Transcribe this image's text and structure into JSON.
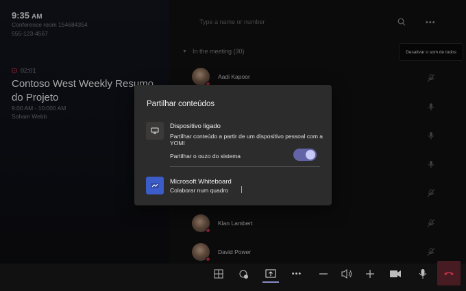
{
  "clock": {
    "time": "9:35",
    "ampm": "AM"
  },
  "room": {
    "name": "Conference room 154684354",
    "phone": "555-123-4567"
  },
  "meeting": {
    "timer": "02:01",
    "title": "Contoso West Weekly Resumo do Projeto",
    "time_range": "9:00 AM - 10:000 AM",
    "organizer": "Soham Webb"
  },
  "search": {
    "placeholder": "Type a name or number"
  },
  "roster": {
    "section_label": "In the meeting (30)",
    "mute_all_tooltip": "Desativar o som de todos",
    "participants": [
      {
        "name": "Aadi Kapoor"
      },
      {
        "name": "Kian Lambert"
      },
      {
        "name": "David Power"
      }
    ]
  },
  "share_dialog": {
    "title": "Partilhar conteúdos",
    "device_option": {
      "title": "Dispositivo ligado",
      "subtitle": "Partilhar conteúdo a partir de um dispositivo pessoal com a YOMI"
    },
    "system_audio": {
      "label": "Partilhar o ouzo do sistema",
      "enabled": true
    },
    "whiteboard_option": {
      "title": "Microsoft Whiteboard",
      "subtitle": "Colaborar num quadro"
    }
  },
  "colors": {
    "accent": "#6264a7",
    "hangup": "#c4314b",
    "whiteboard": "#3b5cc9"
  },
  "controls": [
    "gallery-icon",
    "reactions-icon",
    "share-icon",
    "more-icon",
    "volume-down-icon",
    "speaker-icon",
    "volume-up-icon",
    "camera-icon",
    "mic-icon",
    "hangup-icon"
  ]
}
